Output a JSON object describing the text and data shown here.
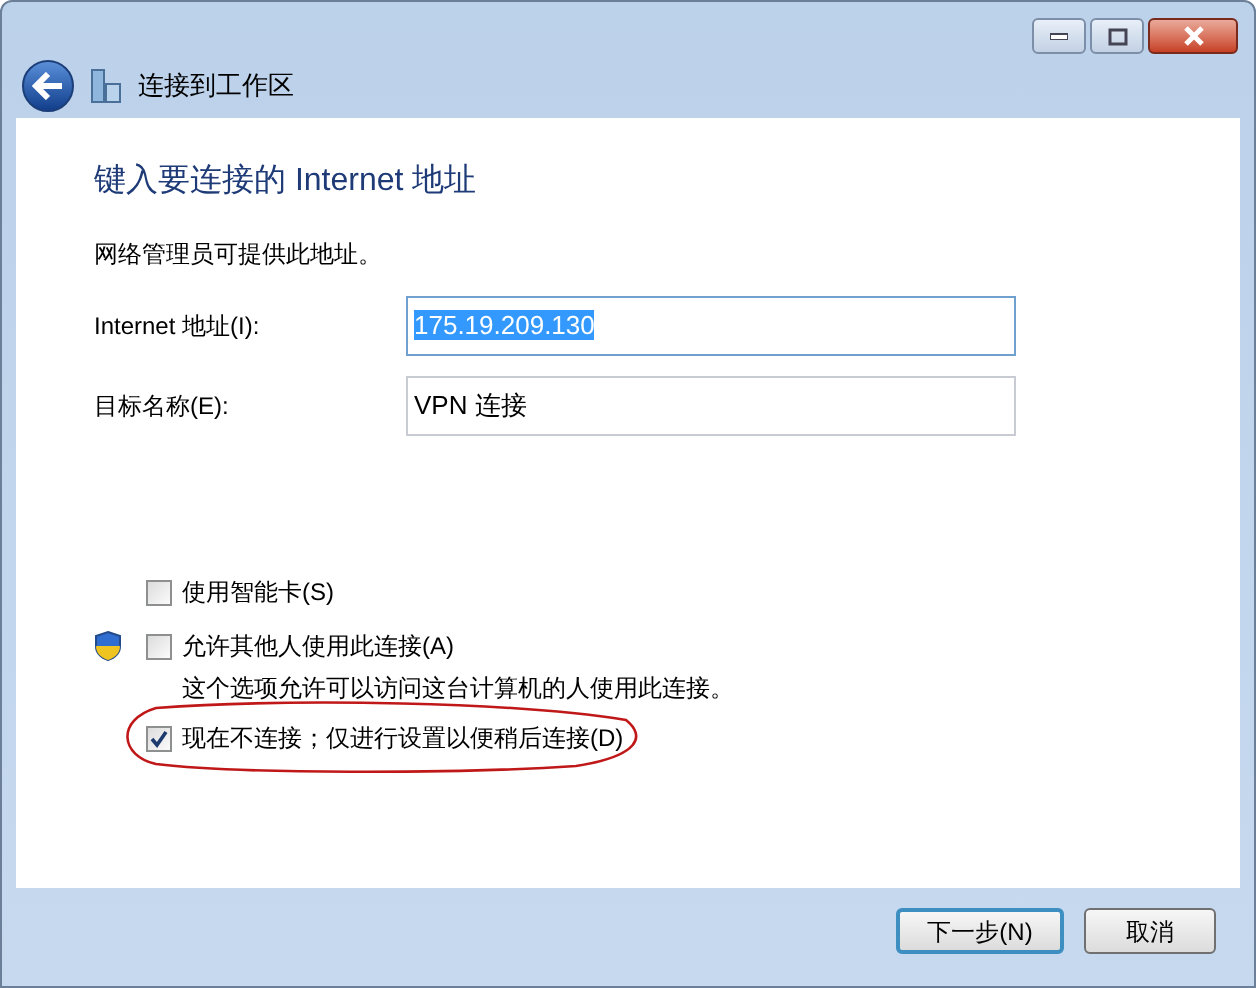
{
  "window": {
    "title": "连接到工作区"
  },
  "heading": "键入要连接的 Internet 地址",
  "description": "网络管理员可提供此地址。",
  "fields": [
    {
      "label": "Internet 地址(I):",
      "value": "175.19.209.130",
      "text_selected": true
    },
    {
      "label": "目标名称(E):",
      "value": "VPN 连接",
      "text_selected": false
    }
  ],
  "options": [
    {
      "label": "使用智能卡(S)",
      "checked": false,
      "shield": false,
      "circled": false
    },
    {
      "label": "允许其他人使用此连接(A)",
      "checked": false,
      "shield": true,
      "note": "这个选项允许可以访问这台计算机的人使用此连接。",
      "circled": false
    },
    {
      "label": "现在不连接；仅进行设置以便稍后连接(D)",
      "checked": true,
      "shield": false,
      "circled": true
    }
  ],
  "buttons": [
    {
      "label": "下一步(N)",
      "default": true
    },
    {
      "label": "取消",
      "default": false
    }
  ]
}
